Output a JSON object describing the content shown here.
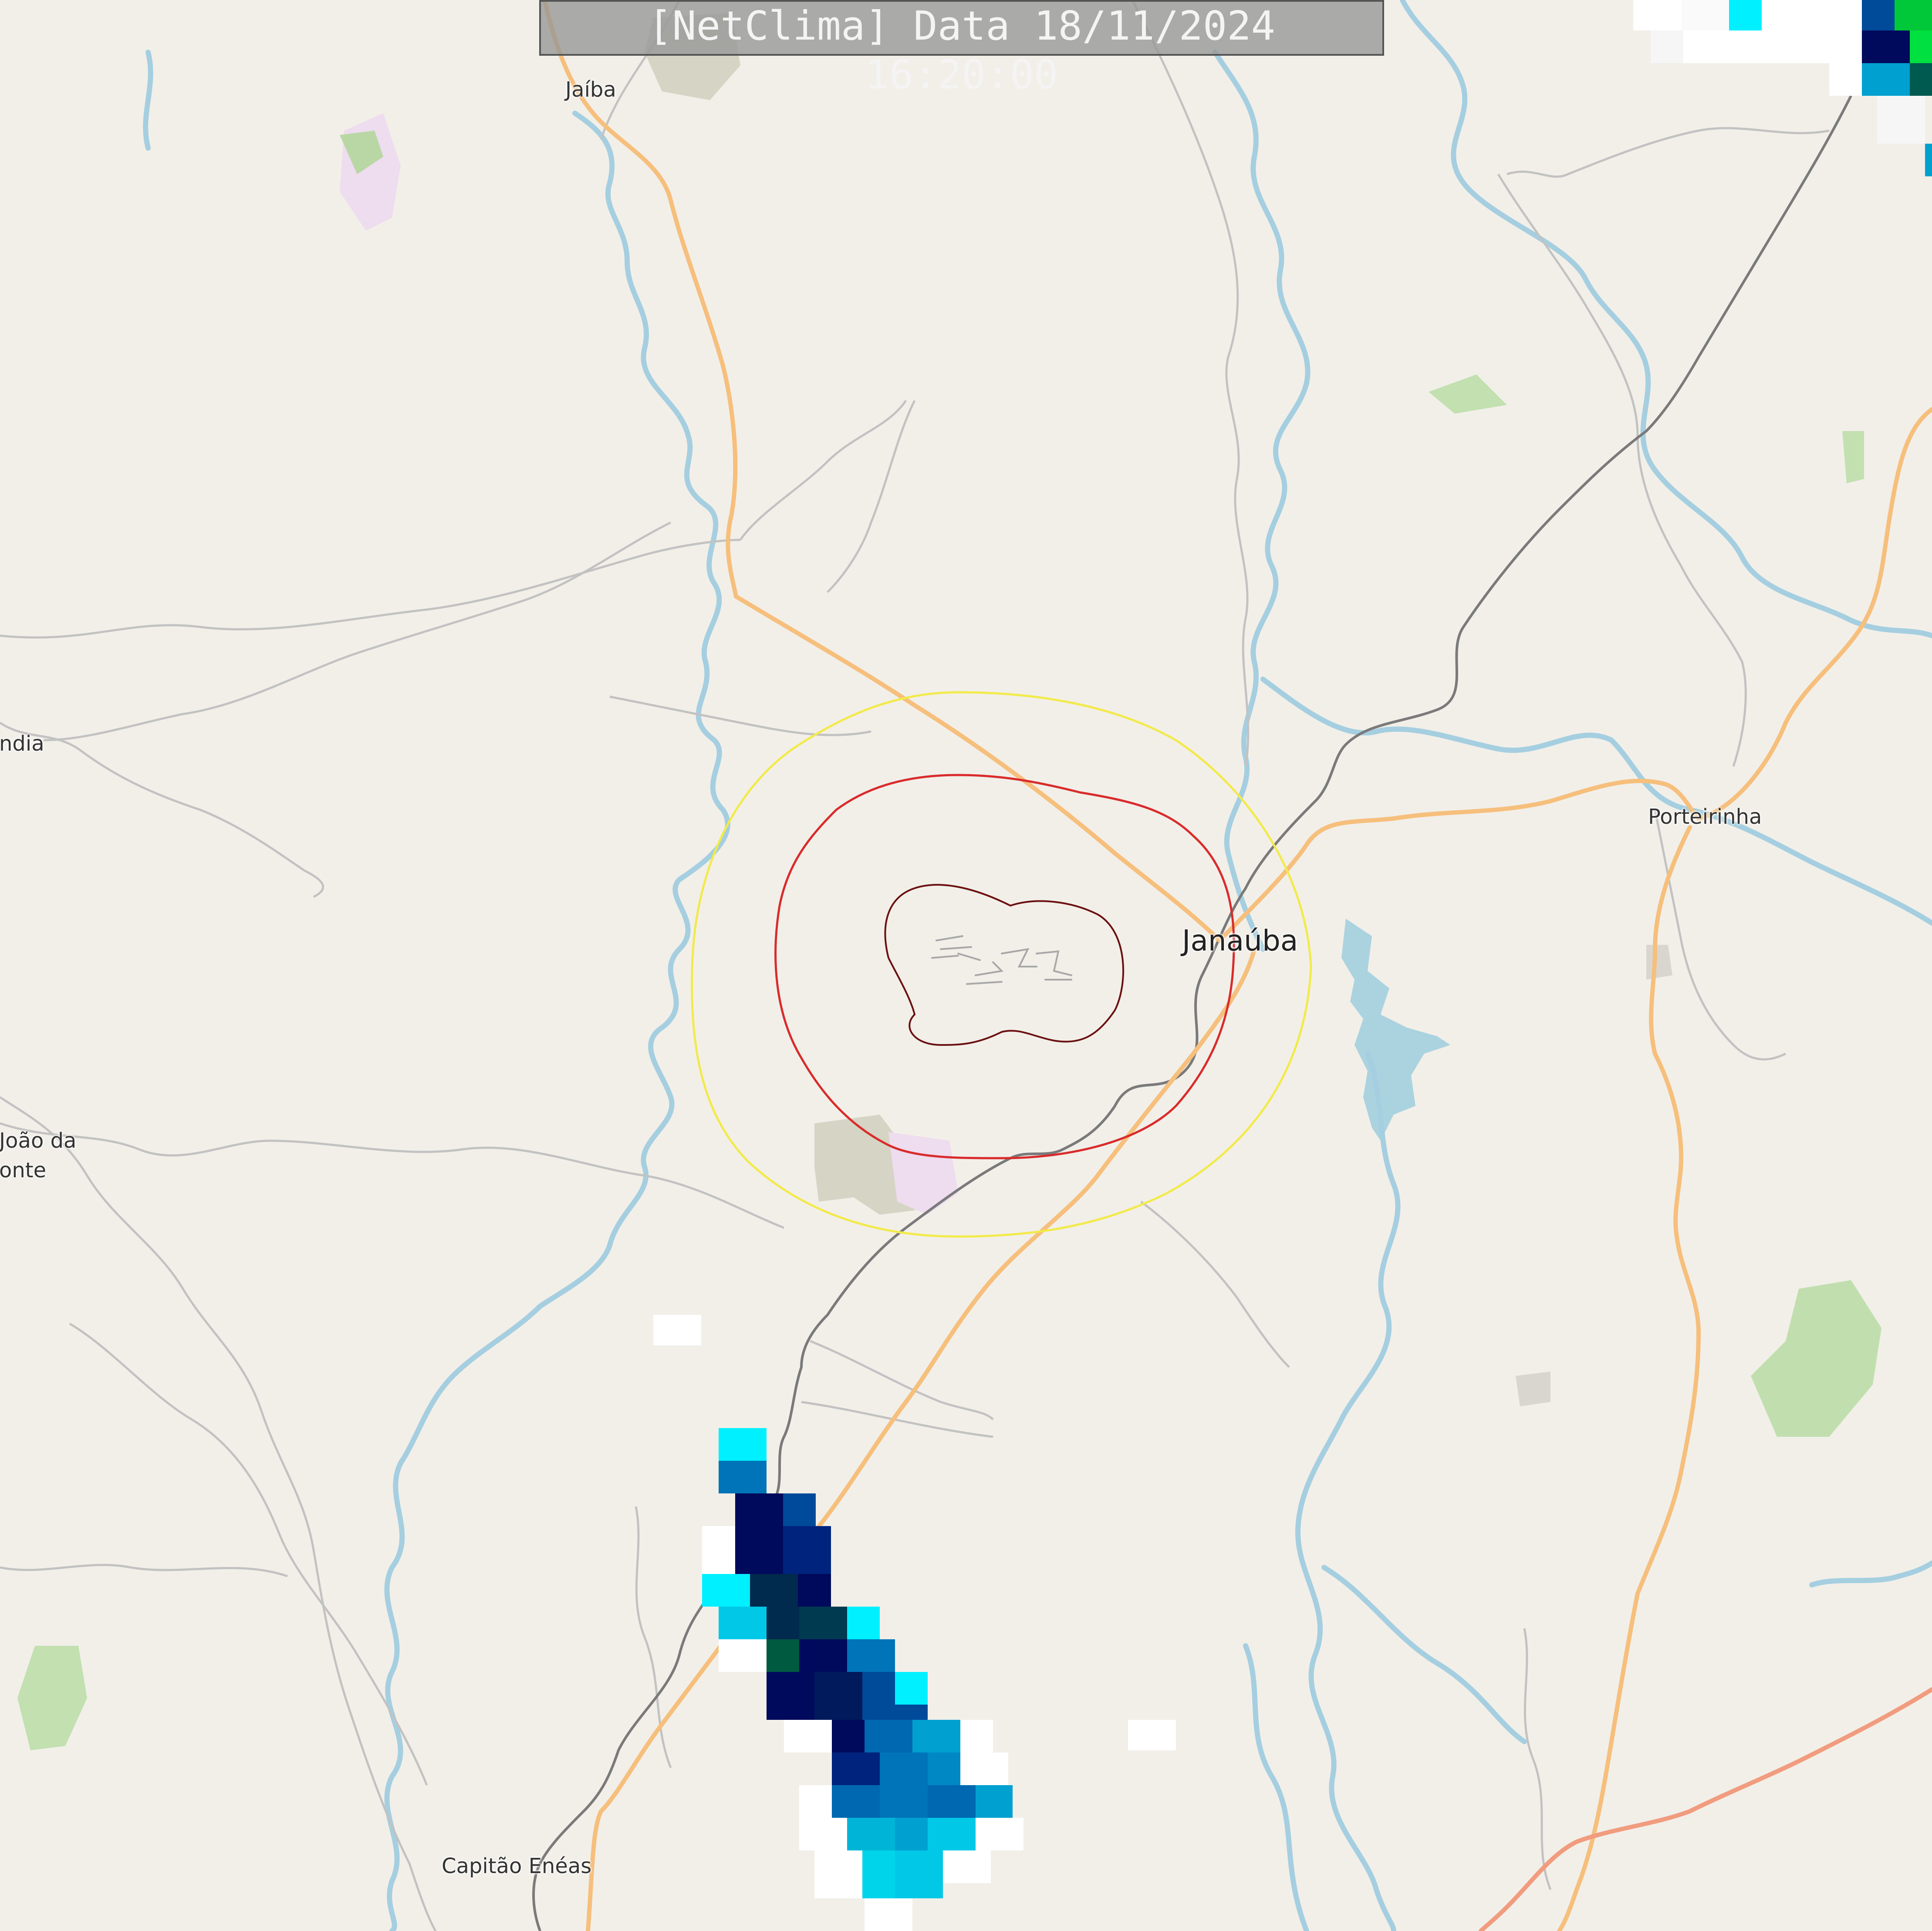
{
  "title": "[NetClima] Data 18/11/2024 16:20:00",
  "places": [
    {
      "key": "jaiba",
      "label": "Jaíba"
    },
    {
      "key": "janauba",
      "label": "Janaúba"
    },
    {
      "key": "porteirinha",
      "label": "Porteirinha"
    },
    {
      "key": "ndia",
      "label": "ndia"
    },
    {
      "key": "joao-da-1",
      "label": "João da"
    },
    {
      "key": "joao-da-2",
      "label": "onte"
    },
    {
      "key": "capitao-eneas",
      "label": "Capitão Enéas"
    }
  ],
  "colors": {
    "background": "#f2efe9",
    "river": "#a5cfe0",
    "water": "#aad3df",
    "road_major": "#f6bf7c",
    "road_trunk": "#f19c7e",
    "road_minor": "#c2c2c2",
    "railway": "#7a7a7a",
    "ring_outer": "#f2ea4a",
    "ring_middle": "#d92b2b",
    "ring_inner": "#6b1010",
    "radar_scale": [
      "#ffffff",
      "#00f0ff",
      "#00c8e6",
      "#00a0d0",
      "#0074b8",
      "#004a9a",
      "#00237e",
      "#000a5c",
      "#002a4e",
      "#005a40",
      "#00c838"
    ]
  }
}
